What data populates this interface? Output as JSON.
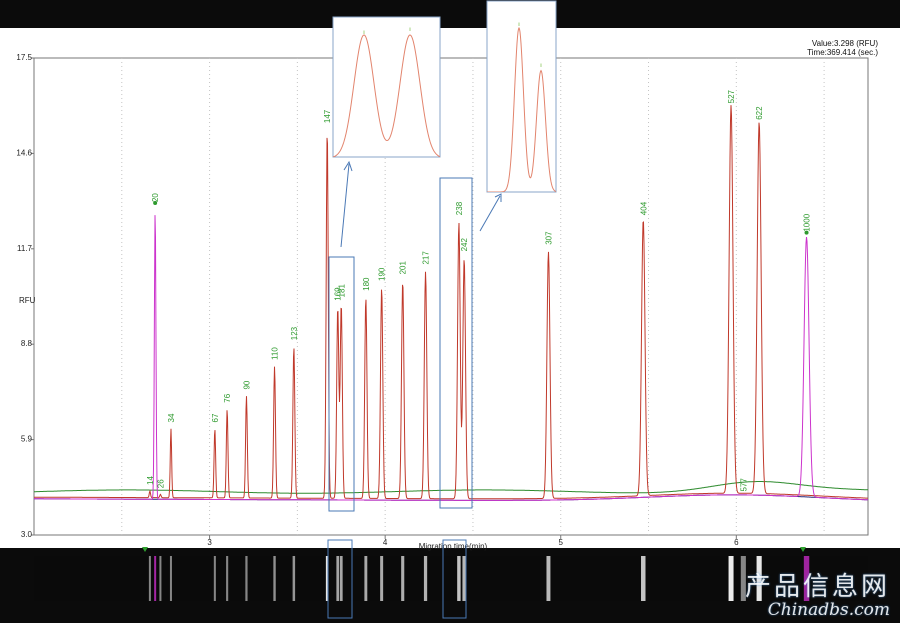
{
  "readout": {
    "value": "Value:3.298 (RFU)",
    "time": "Time:369.414 (sec.)"
  },
  "watermark": {
    "line1": "产品信息网",
    "line2": "Chinadbs.com"
  },
  "colors": {
    "sample_trace": "#c0392b",
    "marker_trace": "#cc33cc",
    "green_baseline": "#2e8b2e",
    "blue_baseline": "#26267a",
    "peak_label": "#2e9a2e",
    "highlight_box": "#4a78b5",
    "gel_background": "#0a0a0a",
    "gel_band": "#ffffff",
    "gel_marker_band": "#d22ed2"
  },
  "chart_data": {
    "type": "line",
    "ylabel": "RFU",
    "xlabel": "Migration time(min)",
    "xlim": [
      2.0,
      6.75
    ],
    "ylim": [
      3.0,
      17.5
    ],
    "yticks": [
      "3.0",
      "5.9",
      "8.8",
      "11.7",
      "14.6",
      "17.5"
    ],
    "xticks": [
      "3",
      "4",
      "5",
      "6"
    ],
    "grid": "vertical dotted",
    "baseline_rfu": 4.2,
    "peaks": [
      {
        "label": "14",
        "time": 2.66,
        "height": 4.4,
        "series": "sample"
      },
      {
        "label": "20",
        "time": 2.69,
        "height": 13.0,
        "series": "marker"
      },
      {
        "label": "26",
        "time": 2.72,
        "height": 4.3,
        "series": "sample"
      },
      {
        "label": "34",
        "time": 2.78,
        "height": 6.3,
        "series": "sample"
      },
      {
        "label": "67",
        "time": 3.03,
        "height": 6.3,
        "series": "sample"
      },
      {
        "label": "76",
        "time": 3.1,
        "height": 6.9,
        "series": "sample"
      },
      {
        "label": "90",
        "time": 3.21,
        "height": 7.3,
        "series": "sample"
      },
      {
        "label": "110",
        "time": 3.37,
        "height": 8.2,
        "series": "sample"
      },
      {
        "label": "123",
        "time": 3.48,
        "height": 8.8,
        "series": "sample"
      },
      {
        "label": "147",
        "time": 3.67,
        "height": 15.4,
        "series": "sample"
      },
      {
        "label": "169",
        "time": 3.73,
        "height": 10.0,
        "series": "sample"
      },
      {
        "label": "181",
        "time": 3.75,
        "height": 10.1,
        "series": "sample"
      },
      {
        "label": "180",
        "time": 3.89,
        "height": 10.3,
        "series": "sample"
      },
      {
        "label": "190",
        "time": 3.98,
        "height": 10.6,
        "series": "sample"
      },
      {
        "label": "201",
        "time": 4.1,
        "height": 10.8,
        "series": "sample"
      },
      {
        "label": "217",
        "time": 4.23,
        "height": 11.1,
        "series": "sample"
      },
      {
        "label": "238",
        "time": 4.42,
        "height": 12.6,
        "series": "sample"
      },
      {
        "label": "242",
        "time": 4.45,
        "height": 11.5,
        "series": "sample"
      },
      {
        "label": "307",
        "time": 4.93,
        "height": 11.7,
        "series": "sample"
      },
      {
        "label": "404",
        "time": 5.47,
        "height": 12.6,
        "series": "sample"
      },
      {
        "label": "527",
        "time": 5.97,
        "height": 16.0,
        "series": "sample"
      },
      {
        "label": "577",
        "time": 6.04,
        "height": 4.2,
        "series": "sample"
      },
      {
        "label": "622",
        "time": 6.13,
        "height": 15.5,
        "series": "sample"
      },
      {
        "label": "1000",
        "time": 6.4,
        "height": 12.1,
        "series": "marker"
      }
    ]
  }
}
